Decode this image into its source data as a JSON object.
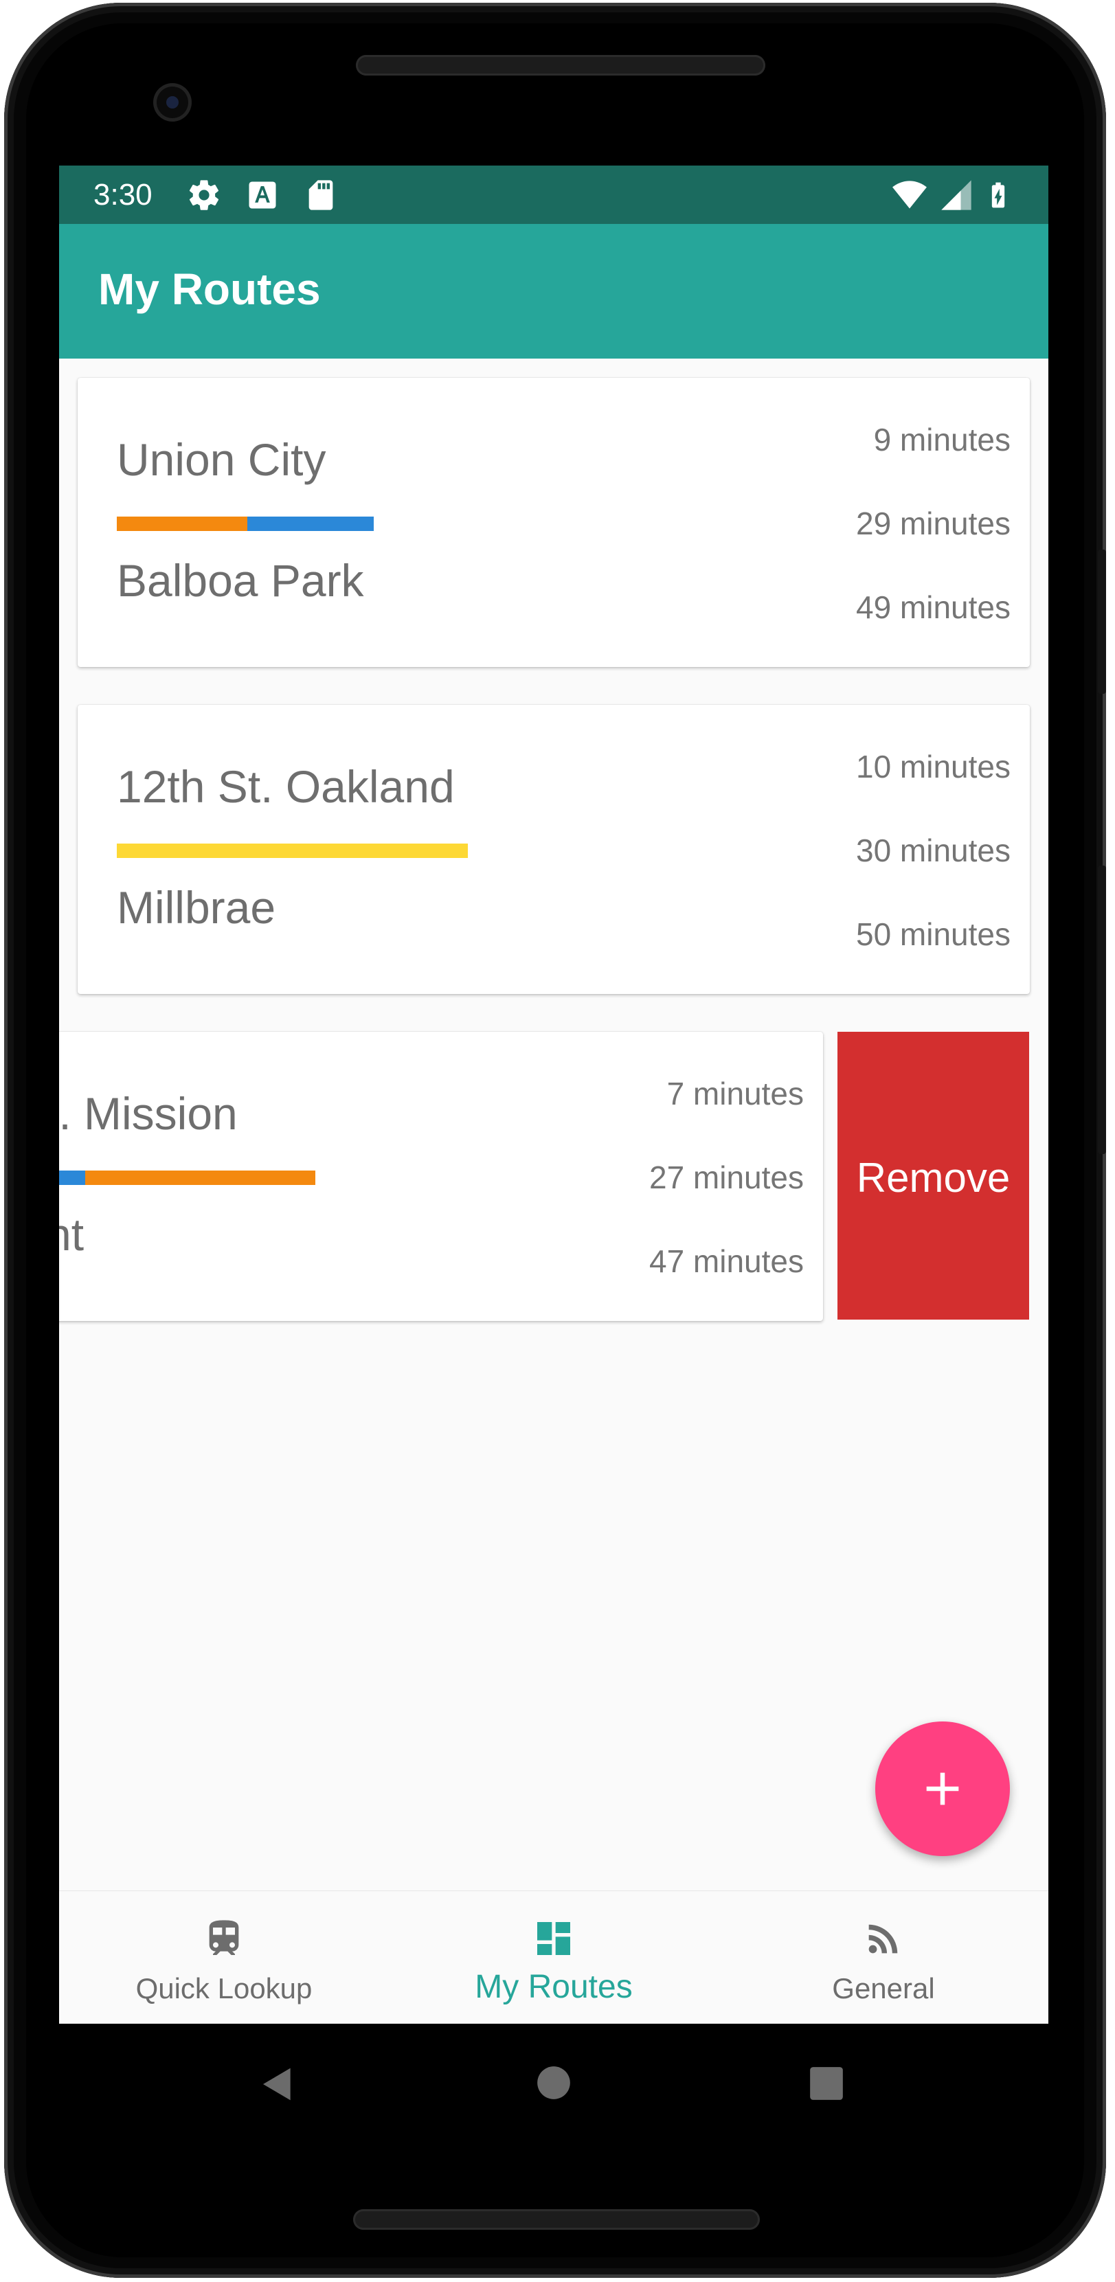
{
  "status_bar": {
    "time": "3:30",
    "left_icons": [
      "gear-icon",
      "font-a-icon",
      "sd-card-icon"
    ],
    "right_icons": [
      "wifi-icon",
      "cell-signal-icon",
      "battery-charging-icon"
    ]
  },
  "app_bar": {
    "title": "My Routes"
  },
  "routes": [
    {
      "origin": "Union City",
      "destination": "Balboa Park",
      "line_colors": [
        "#f4890f",
        "#2b88d8"
      ],
      "etas": [
        "9 minutes",
        "29 minutes",
        "49 minutes"
      ]
    },
    {
      "origin": "12th St. Oakland",
      "destination": "Millbrae",
      "line_colors": [
        "#fdd835"
      ],
      "etas": [
        "10 minutes",
        "30 minutes",
        "50 minutes"
      ]
    },
    {
      "origin": "t. Mission",
      "destination": "nt",
      "line_colors": [
        "#2b88d8",
        "#f4890f"
      ],
      "etas": [
        "7 minutes",
        "27 minutes",
        "47 minutes"
      ],
      "swiped": true
    }
  ],
  "swipe_action": {
    "label": "Remove",
    "color": "#d32f2f"
  },
  "fab": {
    "icon": "plus-icon",
    "color": "#ff4081"
  },
  "bottom_nav": {
    "active": "My Routes",
    "items": [
      {
        "label": "Quick Lookup",
        "icon": "train-icon"
      },
      {
        "label": "My Routes",
        "icon": "dashboard-icon"
      },
      {
        "label": "General",
        "icon": "rss-feed-icon"
      }
    ]
  },
  "system_nav": {
    "buttons": [
      "back-icon",
      "home-icon",
      "recents-icon"
    ]
  },
  "colors": {
    "primary": "#26a69a",
    "primary_dark": "#1b6b5f",
    "accent": "#ff4081"
  }
}
